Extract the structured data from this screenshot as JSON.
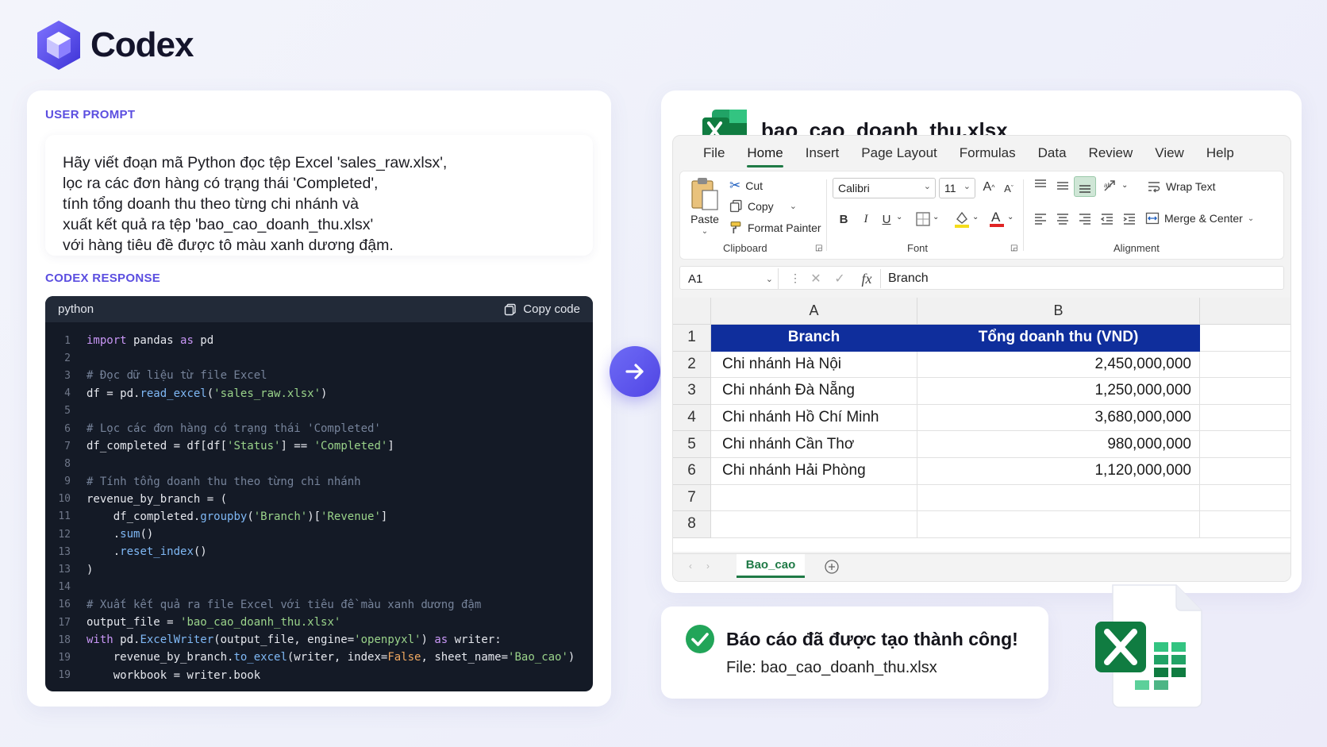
{
  "brand": {
    "name": "Codex"
  },
  "left": {
    "user_prompt_label": "USER PROMPT",
    "prompt_lines": [
      "Hãy viết đoạn mã Python đọc tệp Excel 'sales_raw.xlsx',",
      "lọc ra các đơn hàng có trạng thái 'Completed',",
      "tính tổng doanh thu theo từng chi nhánh và",
      "xuất kết quả ra tệp 'bao_cao_doanh_thu.xlsx'",
      "với hàng tiêu đề được tô màu xanh dương đậm."
    ],
    "response_label": "CODEX RESPONSE",
    "code_language": "python",
    "copy_label": "Copy code",
    "code_lines": [
      {
        "n": "1",
        "text": "import pandas as pd"
      },
      {
        "n": "2",
        "text": ""
      },
      {
        "n": "3",
        "text": "# Đọc dữ liệu từ file Excel"
      },
      {
        "n": "4",
        "text": "df = pd.read_excel('sales_raw.xlsx')"
      },
      {
        "n": "5",
        "text": ""
      },
      {
        "n": "6",
        "text": "# Lọc các đơn hàng có trạng thái 'Completed'"
      },
      {
        "n": "7",
        "text": "df_completed = df[df['Status'] == 'Completed']"
      },
      {
        "n": "8",
        "text": ""
      },
      {
        "n": "9",
        "text": "# Tính tổng doanh thu theo từng chi nhánh"
      },
      {
        "n": "10",
        "text": "revenue_by_branch = ("
      },
      {
        "n": "11",
        "text": "    df_completed.groupby('Branch')['Revenue']"
      },
      {
        "n": "12",
        "text": "    .sum()"
      },
      {
        "n": "13",
        "text": "    .reset_index()"
      },
      {
        "n": "13",
        "text": ")"
      },
      {
        "n": "14",
        "text": ""
      },
      {
        "n": "16",
        "text": "# Xuất kết quả ra file Excel với tiêu đề màu xanh dương đậm"
      },
      {
        "n": "17",
        "text": "output_file = 'bao_cao_doanh_thu.xlsx'"
      },
      {
        "n": "18",
        "text": "with pd.ExcelWriter(output_file, engine='openpyxl') as writer:"
      },
      {
        "n": "19",
        "text": "    revenue_by_branch.to_excel(writer, index=False, sheet_name='Bao_cao')"
      },
      {
        "n": "19",
        "text": "    workbook = writer.book"
      }
    ]
  },
  "right": {
    "file_name": "bao_cao_doanh_thu.xlsx",
    "menu_tabs": [
      "File",
      "Home",
      "Insert",
      "Page Layout",
      "Formulas",
      "Data",
      "Review",
      "View",
      "Help"
    ],
    "active_tab": "Home",
    "ribbon": {
      "paste": "Paste",
      "cut": "Cut",
      "copy": "Copy",
      "format_painter": "Format Painter",
      "clipboard_group": "Clipboard",
      "font_name": "Calibri",
      "font_size": "11",
      "font_group": "Font",
      "bold": "B",
      "italic": "I",
      "underline": "U",
      "wrap_text": "Wrap Text",
      "merge_center": "Merge & Center",
      "alignment_group": "Alignment"
    },
    "name_box": "A1",
    "fx": "fx",
    "formula_value": "Branch",
    "columns": [
      "A",
      "B"
    ],
    "row_numbers": [
      "1",
      "2",
      "3",
      "4",
      "5",
      "6",
      "7",
      "8"
    ],
    "headers": [
      "Branch",
      "Tổng doanh thu (VND)"
    ],
    "rows": [
      [
        "Chi nhánh Hà Nội",
        "2,450,000,000"
      ],
      [
        "Chi nhánh Đà Nẵng",
        "1,250,000,000"
      ],
      [
        "Chi nhánh Hồ Chí Minh",
        "3,680,000,000"
      ],
      [
        "Chi nhánh Cần Thơ",
        "980,000,000"
      ],
      [
        "Chi nhánh Hải Phòng",
        "1,120,000,000"
      ]
    ],
    "sheet_tab": "Bao_cao"
  },
  "success": {
    "title": "Báo cáo đã được tạo thành công!",
    "file": "File: bao_cao_doanh_thu.xlsx"
  },
  "colors": {
    "accent": "#5b4ee0",
    "header_fill": "#0f2e9c",
    "excel_green": "#1f7a46",
    "success_green": "#22a559"
  }
}
